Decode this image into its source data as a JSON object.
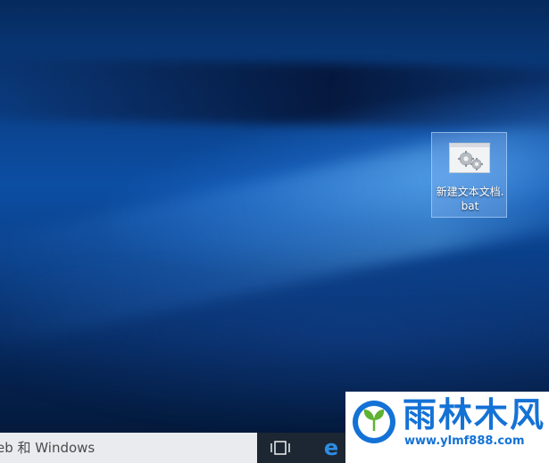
{
  "desktop": {
    "icons": [
      {
        "label": "新建文本文档.bat",
        "icon": "batch-file-gears-icon"
      }
    ]
  },
  "taskbar": {
    "search_text": "eb 和 Windows",
    "buttons": [
      {
        "name": "task-view",
        "icon": "task-view-icon"
      },
      {
        "name": "edge",
        "icon": "edge-icon",
        "glyph": "e"
      },
      {
        "name": "file-explorer",
        "icon": "folder-icon"
      }
    ]
  },
  "watermark": {
    "title": "雨林木风",
    "url": "www.ylmf888.com",
    "logo": "ylmf-leaf-logo"
  },
  "colors": {
    "desktop_blue": "#0c4ea3",
    "taskbar": "#1c2733",
    "search_box": "#e9ebee",
    "edge_blue": "#2d8de3",
    "watermark_blue": "#1472d6",
    "watermark_green": "#5fb233"
  }
}
